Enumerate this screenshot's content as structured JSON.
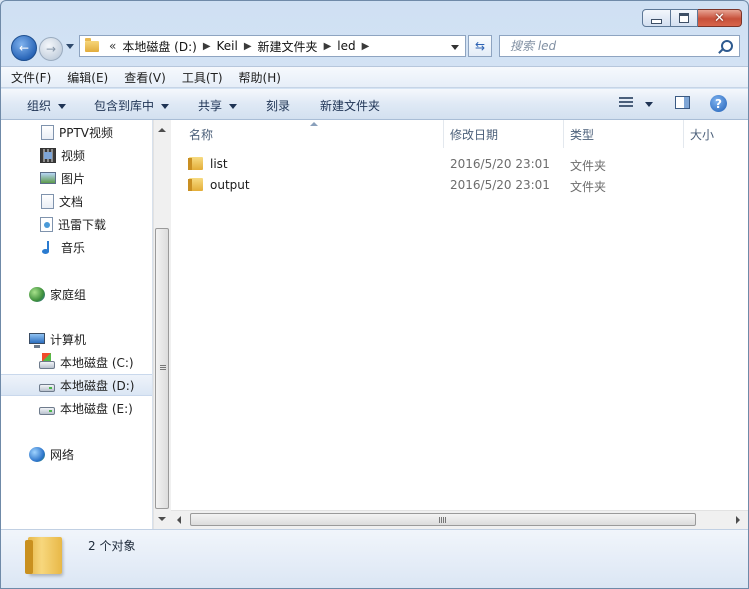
{
  "window": {
    "minimize_icon": "minimize-icon",
    "maximize_icon": "maximize-icon",
    "close_icon": "close-icon"
  },
  "nav": {
    "overflow": "«",
    "breadcrumbs": [
      "本地磁盘 (D:)",
      "Keil",
      "新建文件夹",
      "led"
    ],
    "search_placeholder": "搜索 led"
  },
  "menu": [
    "文件(F)",
    "编辑(E)",
    "查看(V)",
    "工具(T)",
    "帮助(H)"
  ],
  "toolbar": {
    "organize": "组织",
    "include_in_library": "包含到库中",
    "share": "共享",
    "burn": "刻录",
    "new_folder": "新建文件夹"
  },
  "sidebar": {
    "items": [
      {
        "label": "PPTV视频",
        "icon": "document-icon"
      },
      {
        "label": "视频",
        "icon": "video-icon"
      },
      {
        "label": "图片",
        "icon": "picture-icon"
      },
      {
        "label": "文档",
        "icon": "document-icon"
      },
      {
        "label": "迅雷下载",
        "icon": "download-icon"
      },
      {
        "label": "音乐",
        "icon": "music-icon"
      },
      {
        "label": "家庭组",
        "icon": "homegroup-icon"
      },
      {
        "label": "计算机",
        "icon": "computer-icon"
      },
      {
        "label": "本地磁盘 (C:)",
        "icon": "system-drive-icon"
      },
      {
        "label": "本地磁盘 (D:)",
        "icon": "drive-icon",
        "selected": true
      },
      {
        "label": "本地磁盘 (E:)",
        "icon": "drive-icon"
      },
      {
        "label": "网络",
        "icon": "network-icon"
      }
    ]
  },
  "columns": {
    "name": "名称",
    "modified": "修改日期",
    "type": "类型",
    "size": "大小"
  },
  "files": [
    {
      "name": "list",
      "modified": "2016/5/20 23:01",
      "type": "文件夹"
    },
    {
      "name": "output",
      "modified": "2016/5/20 23:01",
      "type": "文件夹"
    }
  ],
  "details": {
    "count_text": "2 个对象"
  }
}
